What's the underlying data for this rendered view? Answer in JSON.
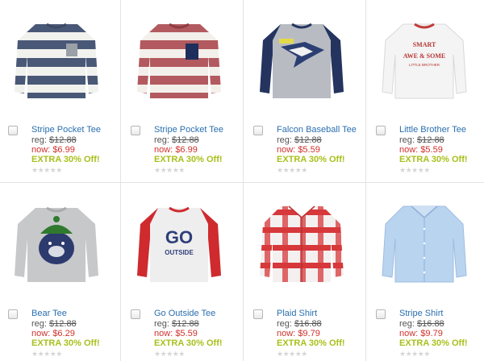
{
  "products": [
    {
      "name": "Stripe Pocket Tee",
      "reg_label": "reg:",
      "reg_price": "$12.88",
      "now_label": "now:",
      "now_price": "$6.99",
      "promo": "EXTRA 30% Off!",
      "stars": "★★★★★",
      "icon": "striped-navy-tee-icon"
    },
    {
      "name": "Stripe Pocket Tee",
      "reg_label": "reg:",
      "reg_price": "$12.88",
      "now_label": "now:",
      "now_price": "$6.99",
      "promo": "EXTRA 30% Off!",
      "stars": "★★★★★",
      "icon": "striped-red-tee-icon"
    },
    {
      "name": "Falcon Baseball Tee",
      "reg_label": "reg:",
      "reg_price": "$12.88",
      "now_label": "now:",
      "now_price": "$5.59",
      "promo": "EXTRA 30% Off!",
      "stars": "★★★★★",
      "icon": "falcon-tee-icon"
    },
    {
      "name": "Little Brother Tee",
      "reg_label": "reg:",
      "reg_price": "$12.88",
      "now_label": "now:",
      "now_price": "$5.59",
      "promo": "EXTRA 30% Off!",
      "stars": "★★★★★",
      "icon": "little-brother-tee-icon"
    },
    {
      "name": "Bear Tee",
      "reg_label": "reg:",
      "reg_price": "$12.88",
      "now_label": "now:",
      "now_price": "$6.29",
      "promo": "EXTRA 30% Off!",
      "stars": "★★★★★",
      "icon": "bear-tee-icon"
    },
    {
      "name": "Go Outside Tee",
      "reg_label": "reg:",
      "reg_price": "$12.88",
      "now_label": "now:",
      "now_price": "$5.59",
      "promo": "EXTRA 30% Off!",
      "stars": "★★★★★",
      "icon": "go-outside-tee-icon"
    },
    {
      "name": "Plaid Shirt",
      "reg_label": "reg:",
      "reg_price": "$16.88",
      "now_label": "now:",
      "now_price": "$9.79",
      "promo": "EXTRA 30% Off!",
      "stars": "★★★★★",
      "icon": "plaid-shirt-icon"
    },
    {
      "name": "Stripe Shirt",
      "reg_label": "reg:",
      "reg_price": "$16.88",
      "now_label": "now:",
      "now_price": "$9.79",
      "promo": "EXTRA 30% Off!",
      "stars": "★★★★★",
      "icon": "stripe-shirt-icon"
    }
  ],
  "shirt_art": {
    "t0_text": "",
    "t2_text": "",
    "t3_line1": "SMART",
    "t3_line2": "AWE & SOME",
    "t3_line3": "LITTLE BROTHER",
    "t5_line1": "GO",
    "t5_line2": "OUTSIDE"
  },
  "colors": {
    "link": "#2a6fb0",
    "sale": "#d0312d",
    "promo": "#a9c01c"
  }
}
